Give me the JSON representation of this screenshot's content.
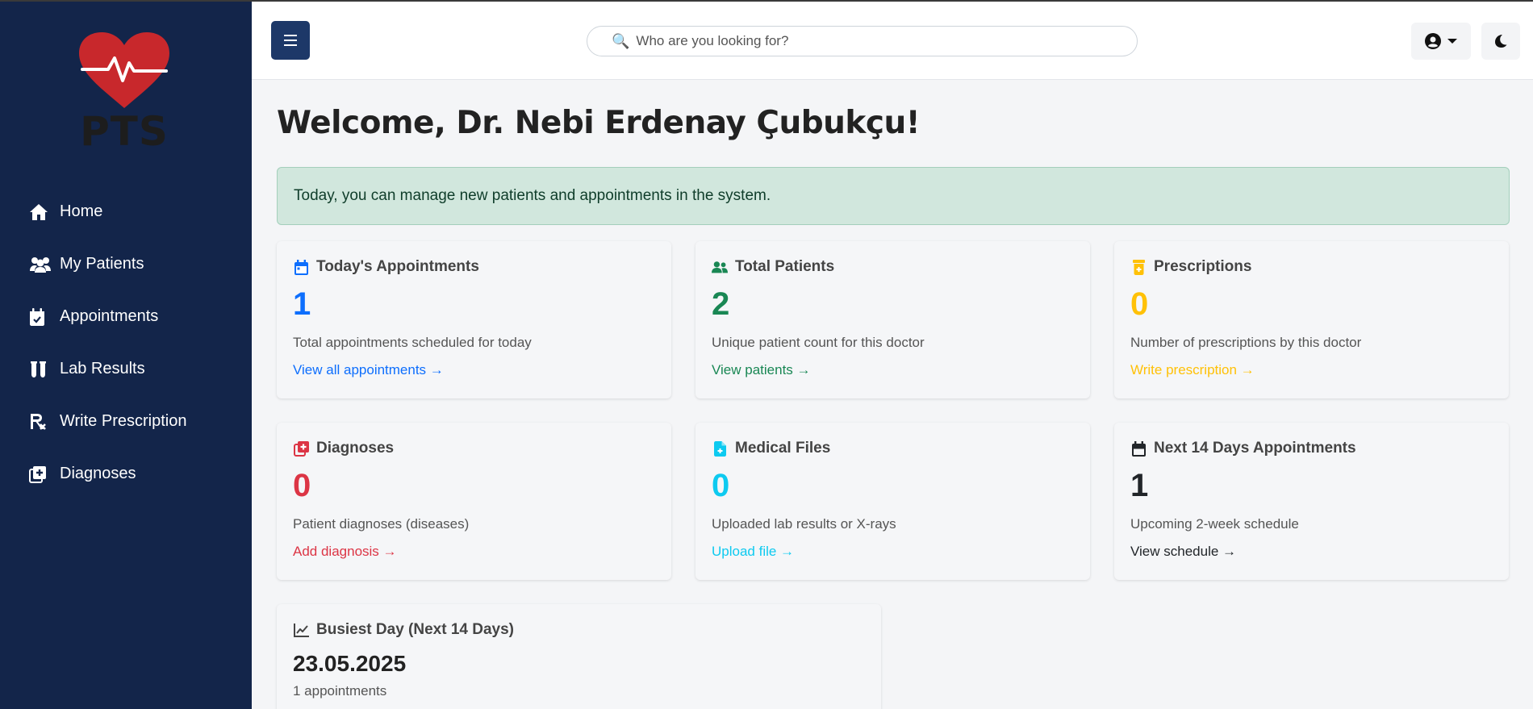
{
  "sidebar": {
    "logo_text": "PTS",
    "items": [
      {
        "label": "Home",
        "icon": "home-icon"
      },
      {
        "label": "My Patients",
        "icon": "users-icon"
      },
      {
        "label": "Appointments",
        "icon": "calendar-check-icon"
      },
      {
        "label": "Lab Results",
        "icon": "vials-icon"
      },
      {
        "label": "Write Prescription",
        "icon": "prescription-icon"
      },
      {
        "label": "Diagnoses",
        "icon": "diagnoses-icon"
      }
    ]
  },
  "header": {
    "search_placeholder": "Who are you looking for?",
    "search_icon": "🔍"
  },
  "main": {
    "welcome": "Welcome, Dr. Nebi Erdenay Çubukçu!",
    "alert": "Today, you can manage new patients and appointments in the system.",
    "cards": [
      {
        "title": "Today's Appointments",
        "value": "1",
        "desc": "Total appointments scheduled for today",
        "link": "View all appointments →",
        "color": "#0d6efd",
        "icon": "calendar-icon"
      },
      {
        "title": "Total Patients",
        "value": "2",
        "desc": "Unique patient count for this doctor",
        "link": "View patients →",
        "color": "#198754",
        "icon": "users-icon"
      },
      {
        "title": "Prescriptions",
        "value": "0",
        "desc": "Number of prescriptions by this doctor",
        "link": "Write prescription →",
        "color": "#ffc107",
        "icon": "prescription-bottle-icon"
      },
      {
        "title": "Diagnoses",
        "value": "0",
        "desc": "Patient diagnoses (diseases)",
        "link": "Add diagnosis →",
        "color": "#dc3545",
        "icon": "diagnoses-icon"
      },
      {
        "title": "Medical Files",
        "value": "0",
        "desc": "Uploaded lab results or X-rays",
        "link": "Upload file →",
        "color": "#0dcaf0",
        "icon": "file-medical-icon"
      },
      {
        "title": "Next 14 Days Appointments",
        "value": "1",
        "desc": "Upcoming 2-week schedule",
        "link": "View schedule →",
        "color": "#212529",
        "icon": "calendar-icon"
      }
    ],
    "busiest": {
      "title": "Busiest Day (Next 14 Days)",
      "date": "23.05.2025",
      "sub": "1 appointments",
      "icon": "chart-line-icon"
    }
  },
  "colors": {
    "sidebar_bg": "#13254a",
    "heart": "#c8282c",
    "alert_bg": "#d1e7dd"
  }
}
